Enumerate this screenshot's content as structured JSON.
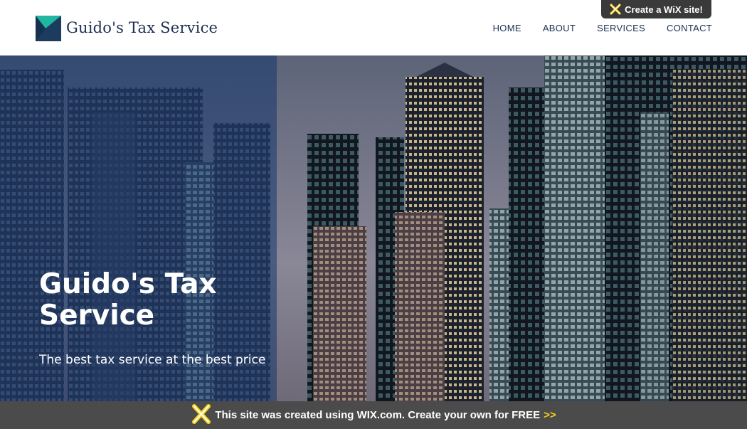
{
  "brand": {
    "name": "Guido's Tax Service"
  },
  "nav": {
    "items": [
      "HOME",
      "ABOUT",
      "SERVICES",
      "CONTACT"
    ]
  },
  "wix_tab": {
    "label": "Create a WiX site!"
  },
  "hero": {
    "title_line1": "Guido's Tax",
    "title_line2": "Service",
    "subtitle": "The best tax service at the best price"
  },
  "banner": {
    "text": "This site was created using WIX.com. Create your own for FREE",
    "arrows": ">>"
  },
  "colors": {
    "navy": "#1c2f52",
    "logo_teal": "#1fb7a0",
    "logo_navy": "#1d3a5f",
    "overlay": "#16366e",
    "banner_bg": "#4b4b4b",
    "banner_accent": "#f6d21e"
  },
  "icons": {
    "logo": "logo-mark-icon",
    "wix": "wix-x-icon"
  }
}
